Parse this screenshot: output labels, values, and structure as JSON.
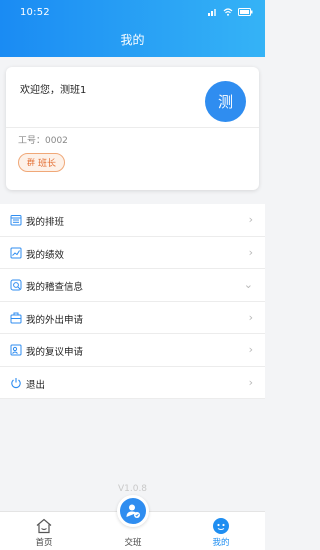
{
  "status_bar": {
    "time": "10:52"
  },
  "header": {
    "title": "我的"
  },
  "profile": {
    "welcome": "欢迎您，测班1",
    "avatar_text": "测",
    "employee_no": "工号：0002",
    "role_icon": "群",
    "role": "班长"
  },
  "menu": [
    {
      "label": "我的排班",
      "icon": "schedule-icon"
    },
    {
      "label": "我的绩效",
      "icon": "performance-icon"
    },
    {
      "label": "我的稽查信息",
      "icon": "inspection-icon"
    },
    {
      "label": "我的外出申请",
      "icon": "outing-icon"
    },
    {
      "label": "我的复议申请",
      "icon": "review-icon"
    },
    {
      "label": "退出",
      "icon": "power-icon"
    }
  ],
  "version": "V1.0.8",
  "bottom_nav": {
    "home": "首页",
    "handover": "交班",
    "mine": "我的"
  },
  "colors": {
    "primary": "#2f8df0",
    "header_start": "#1a8bf3",
    "header_end": "#35b3f6",
    "badge": "#e36c2f"
  }
}
